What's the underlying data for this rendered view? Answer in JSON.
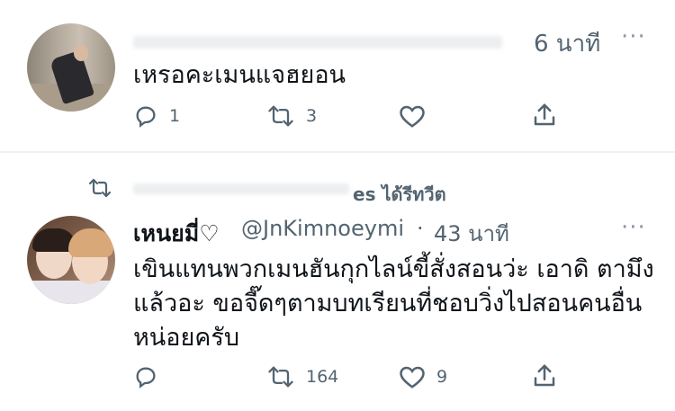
{
  "tweet1": {
    "time": "6 นาที",
    "more_label": "···",
    "text": "เหรอคะเมนแจฮยอน",
    "replies": "1",
    "retweets": "3"
  },
  "retweet_banner": {
    "label": "es ได้รีทวีต"
  },
  "tweet2": {
    "display_name": "เหนยมี่♡",
    "handle": "@JnKimnoeymi",
    "separator": "·",
    "time": "43 นาที",
    "more_label": "···",
    "text_lines": [
      "เขินแทนพวกเมนฮันกุกไลน์ขี้สั่งสอนว่ะ เอาดิ ตามึง",
      "แล้วอะ ขอจี๊ดๆตามบทเรียนที่ชอบวิ่งไปสอนคนอื่น",
      "หน่อยครับ"
    ],
    "replies": "",
    "retweets": "164",
    "likes": "9"
  },
  "colors": {
    "text": "#0f1419",
    "muted": "#536471",
    "divider": "#eff3f4",
    "background": "#ffffff"
  },
  "icons": [
    "reply-icon",
    "retweet-icon",
    "like-icon",
    "share-icon",
    "more-icon"
  ]
}
